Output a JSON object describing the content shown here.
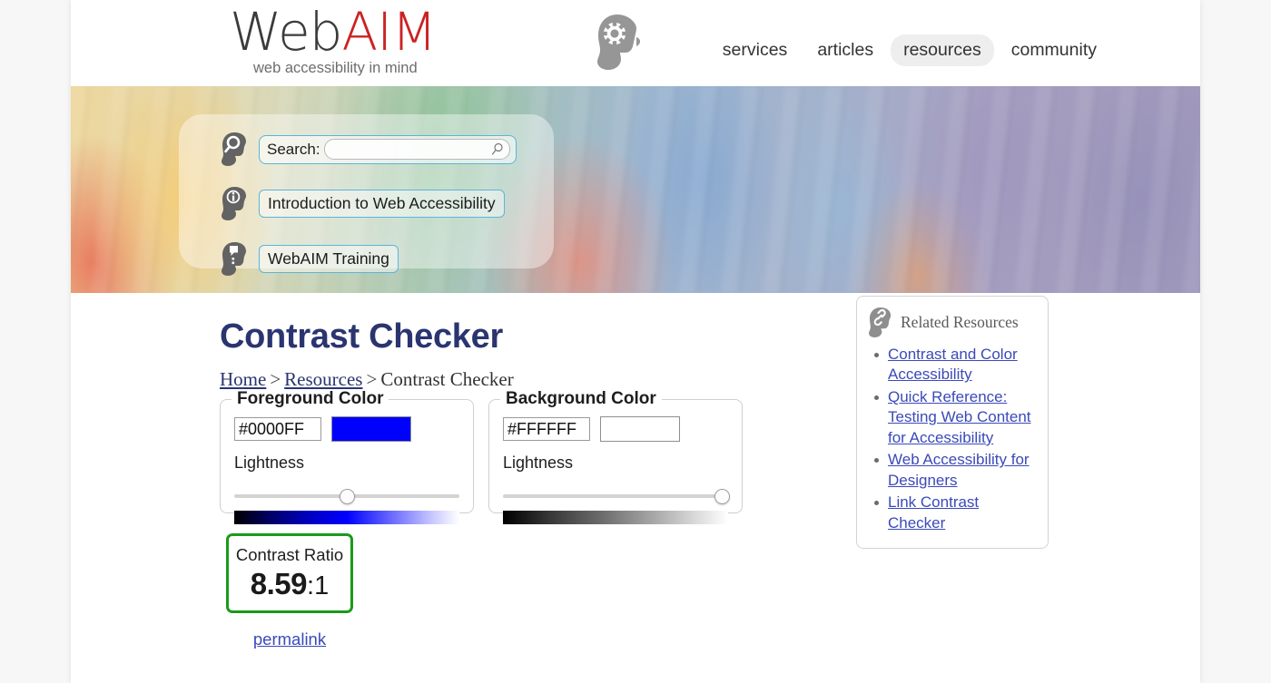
{
  "site": {
    "logo_web": "Web",
    "logo_aim": "AIM",
    "logo_tagline": "web accessibility in mind",
    "logo_head_icon": "head-gear-icon"
  },
  "nav": {
    "items": [
      {
        "label": "services",
        "active": false
      },
      {
        "label": "articles",
        "active": false
      },
      {
        "label": "resources",
        "active": true
      },
      {
        "label": "community",
        "active": false
      }
    ]
  },
  "hero": {
    "search": {
      "label": "Search:",
      "value": "",
      "placeholder": "",
      "icon": "head-search-icon",
      "field_icon": "magnifier-icon"
    },
    "links": [
      {
        "label": "Introduction to Web Accessibility",
        "icon": "head-info-icon"
      },
      {
        "label": "WebAIM Training",
        "icon": "head-training-icon"
      }
    ]
  },
  "page": {
    "title": "Contrast Checker",
    "breadcrumb": {
      "home": "Home",
      "resources": "Resources",
      "current": "Contrast Checker",
      "separator": ">"
    }
  },
  "foreground": {
    "legend": "Foreground Color",
    "hex_value": "#0000FF",
    "swatch_color": "#0000FF",
    "lightness_label": "Lightness",
    "lightness_percent": 50
  },
  "background": {
    "legend": "Background Color",
    "hex_value": "#FFFFFF",
    "swatch_color": "#FFFFFF",
    "lightness_label": "Lightness",
    "lightness_percent": 97
  },
  "result": {
    "ratio_label": "Contrast Ratio",
    "ratio_number": "8.59",
    "ratio_suffix": ":1",
    "border_color": "#1a9a1a",
    "permalink_label": "permalink"
  },
  "related": {
    "title": "Related Resources",
    "icon": "head-link-icon",
    "links": [
      "Contrast and Color Accessibility",
      "Quick Reference: Testing Web Content for Accessibility",
      "Web Accessibility for Designers",
      "Link Contrast Checker"
    ]
  }
}
